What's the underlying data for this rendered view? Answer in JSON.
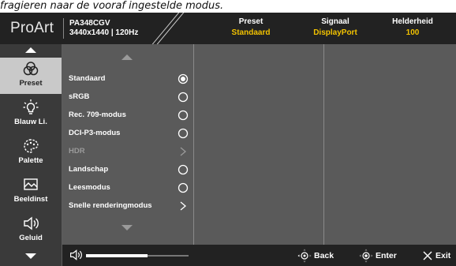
{
  "caption": "fragieren naar de vooraf ingestelde modus.",
  "header": {
    "logo": "ProArt",
    "model": "PA348CGV",
    "resolution": "3440x1440 | 120Hz",
    "columns": [
      {
        "key": "Preset",
        "value": "Standaard"
      },
      {
        "key": "Signaal",
        "value": "DisplayPort"
      },
      {
        "key": "Helderheid",
        "value": "100"
      }
    ]
  },
  "sidebar": {
    "items": [
      {
        "label": "Preset",
        "icon": "preset-icon",
        "active": true
      },
      {
        "label": "Blauw Li.",
        "icon": "bulb-icon",
        "active": false
      },
      {
        "label": "Palette",
        "icon": "palette-icon",
        "active": false
      },
      {
        "label": "Beeldinst",
        "icon": "image-icon",
        "active": false
      },
      {
        "label": "Geluid",
        "icon": "speaker-icon",
        "active": false
      }
    ]
  },
  "menu": {
    "items": [
      {
        "label": "Standaard",
        "control": "radio-selected"
      },
      {
        "label": "sRGB",
        "control": "radio"
      },
      {
        "label": "Rec. 709-modus",
        "control": "radio"
      },
      {
        "label": "DCI-P3-modus",
        "control": "radio"
      },
      {
        "label": "HDR",
        "control": "chevron",
        "disabled": true
      },
      {
        "label": "Landschap",
        "control": "radio"
      },
      {
        "label": "Leesmodus",
        "control": "radio"
      },
      {
        "label": "Snelle renderingmodus",
        "control": "chevron"
      }
    ]
  },
  "footer": {
    "volume_level": 0.6,
    "back_label": "Back",
    "enter_label": "Enter",
    "exit_label": "Exit"
  },
  "colors": {
    "accent_yellow": "#f2c200",
    "header_bg": "#222222",
    "sidebar_bg": "#3a3a3a",
    "panel_bg": "#5a5a5a",
    "active_item_bg": "#c9c9c9"
  }
}
